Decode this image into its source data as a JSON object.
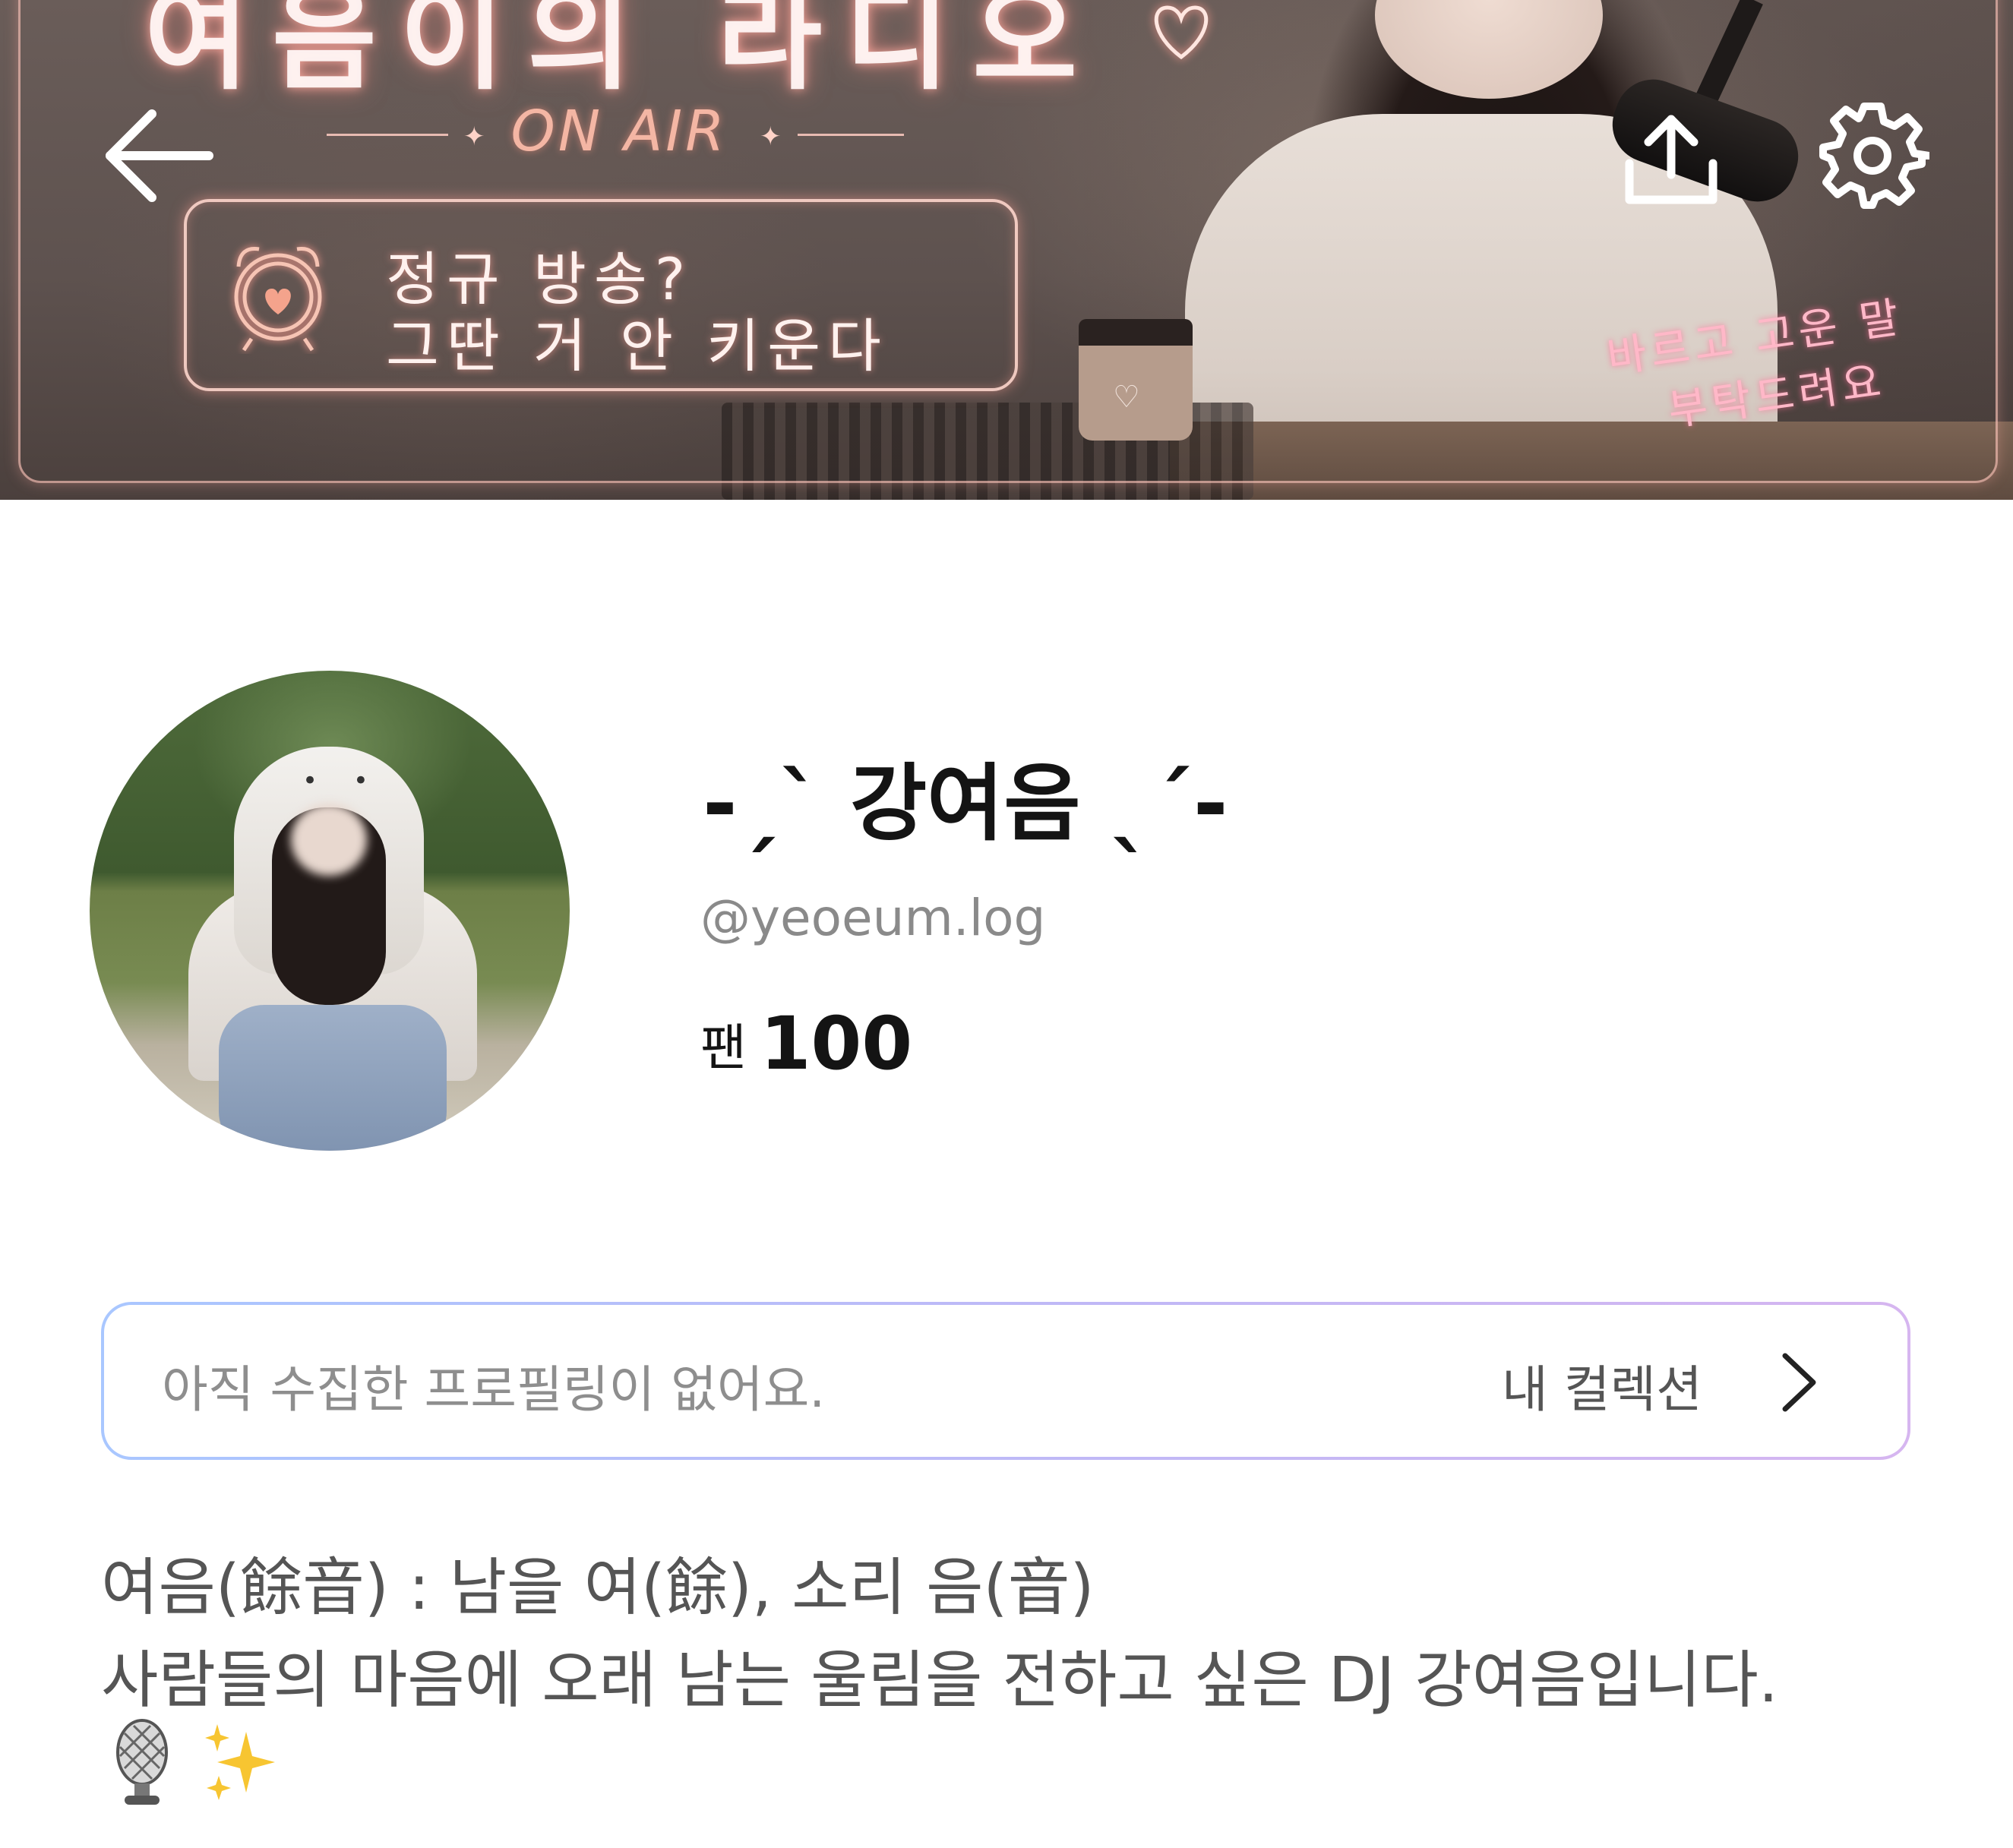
{
  "banner": {
    "title": "여음이의 라디오",
    "onair": "ON AIR",
    "notice_line1": "정규 방송?",
    "notice_line2": "그딴 거 안 키운다",
    "pink_line1": "바르고 고운 말",
    "pink_line2": "부탁드려요",
    "icons": {
      "back": "back-arrow-icon",
      "share": "share-upload-icon",
      "settings": "gear-icon"
    }
  },
  "profile": {
    "display_name": "-ˏˋ 강여음 ˎˊ-",
    "handle": "@yeoeum.log",
    "fans_label": "팬",
    "fans_count": "100"
  },
  "collection": {
    "empty_text": "아직 수집한 프로필링이 없어요.",
    "link_label": "내 컬렉션"
  },
  "bio": {
    "line1": "여음(餘音) : 남을 여(餘), 소리 음(音)",
    "line2": "사람들의 마음에 오래 남는 울림을 전하고 싶은 DJ 강여음입니다.",
    "emojis": [
      "microphone-emoji",
      "sparkles-emoji"
    ]
  },
  "colors": {
    "text_primary": "#141414",
    "text_secondary": "#8a8a8a",
    "bio_text": "#555555",
    "collection_gradient_start": "#a9c7ff",
    "collection_gradient_end": "#d6b6f0",
    "neon_pink": "#f4b6a4"
  }
}
